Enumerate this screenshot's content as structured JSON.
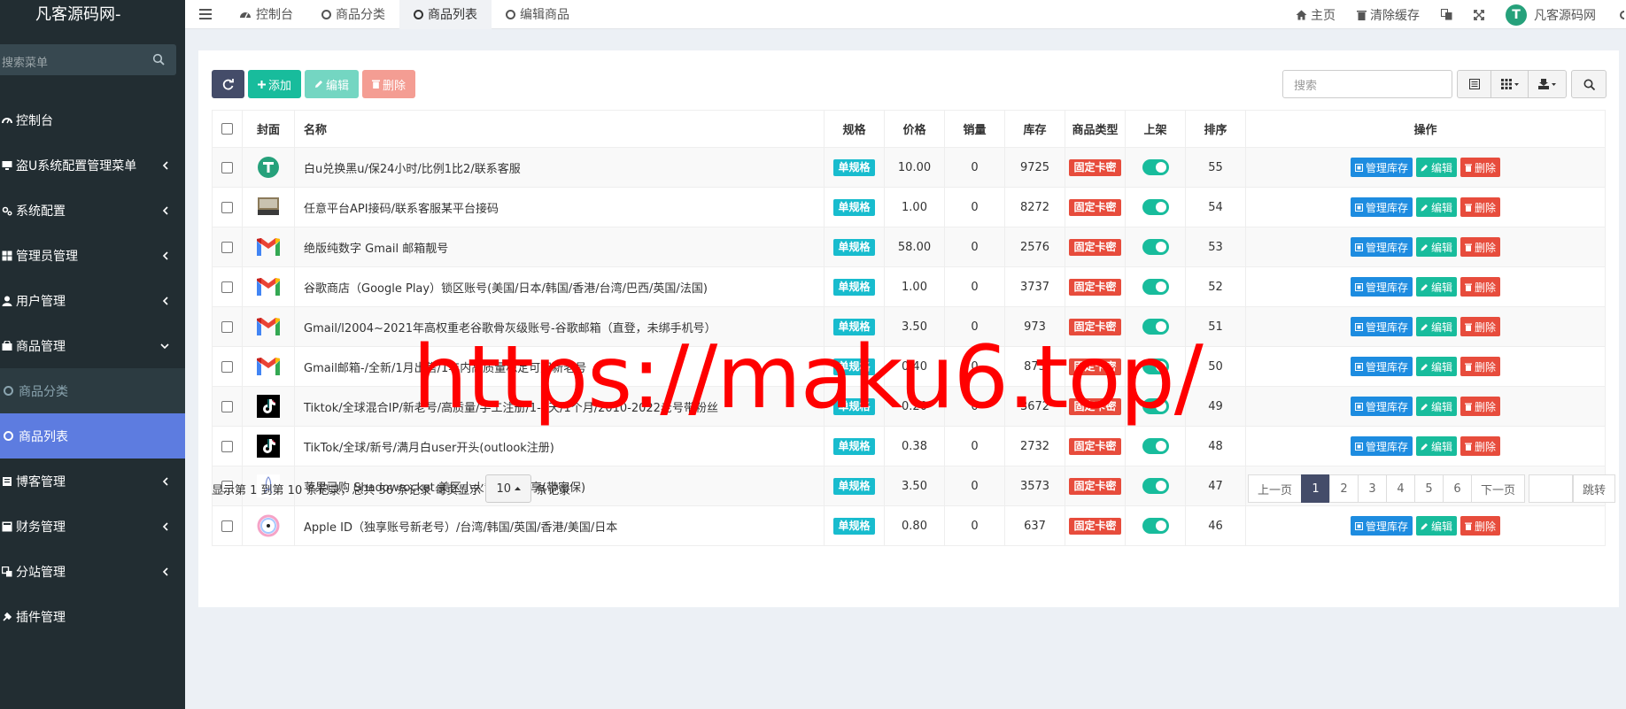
{
  "sidebar": {
    "brand": "凡客源码网-",
    "search_placeholder": "搜索菜单",
    "items": [
      {
        "label": "控制台",
        "icon": "dashboard-icon"
      },
      {
        "label": "盗U系统配置管理菜单",
        "icon": "desktop-icon"
      },
      {
        "label": "系统配置",
        "icon": "cogs-icon"
      },
      {
        "label": "管理员管理",
        "icon": "admin-icon"
      },
      {
        "label": "用户管理",
        "icon": "user-icon"
      },
      {
        "label": "商品管理",
        "icon": "shopping-bag-icon"
      },
      {
        "label": "博客管理",
        "icon": "book-icon"
      },
      {
        "label": "财务管理",
        "icon": "finance-icon"
      },
      {
        "label": "分站管理",
        "icon": "sitemap-icon"
      },
      {
        "label": "插件管理",
        "icon": "plugin-icon"
      }
    ],
    "sub_items": [
      {
        "label": "商品分类"
      },
      {
        "label": "商品列表"
      }
    ]
  },
  "topbar": {
    "tabs": [
      {
        "label": "控制台",
        "icon": "dashboard-icon"
      },
      {
        "label": "商品分类",
        "icon": "circle-icon"
      },
      {
        "label": "商品列表",
        "icon": "circle-icon"
      },
      {
        "label": "编辑商品",
        "icon": "circle-icon"
      }
    ],
    "home_label": "主页",
    "clear_cache_label": "清除缓存",
    "site_name": "凡客源码网"
  },
  "toolbar": {
    "add_label": "添加",
    "edit_label": "编辑",
    "delete_label": "删除",
    "search_placeholder": "搜索"
  },
  "table": {
    "columns": [
      "封面",
      "名称",
      "规格",
      "价格",
      "销量",
      "库存",
      "商品类型",
      "上架",
      "排序",
      "操作"
    ],
    "spec_label": "单规格",
    "type_label": "固定卡密",
    "op_stock_label": "管理库存",
    "op_edit_label": "编辑",
    "op_delete_label": "删除",
    "rows": [
      {
        "cover": "tether",
        "name": "白u兑换黑u/保24小时/比例1比2/联系客服",
        "price": "10.00",
        "sales": "0",
        "stock": "9725",
        "sort": "55"
      },
      {
        "cover": "laptop",
        "name": "任意平台API接码/联系客服某平台接码",
        "price": "1.00",
        "sales": "0",
        "stock": "8272",
        "sort": "54"
      },
      {
        "cover": "gmail",
        "name": "绝版纯数字 Gmail 邮箱靓号",
        "price": "58.00",
        "sales": "0",
        "stock": "2576",
        "sort": "53"
      },
      {
        "cover": "gmail",
        "name": "谷歌商店（Google Play）锁区账号(美国/日本/韩国/香港/台湾/巴西/英国/法国)",
        "price": "1.00",
        "sales": "0",
        "stock": "3737",
        "sort": "52"
      },
      {
        "cover": "gmail",
        "name": "Gmail/l2004~2021年高权重老谷歌骨灰级账号-谷歌邮箱（直登，未绑手机号）",
        "price": "3.50",
        "sales": "0",
        "stock": "973",
        "sort": "51"
      },
      {
        "cover": "gmail",
        "name": "Gmail邮箱-/全新/1月出售/1年内高质量稳定可用新老号",
        "price": "0.40",
        "sales": "0",
        "stock": "873",
        "sort": "50"
      },
      {
        "cover": "tiktok",
        "name": "Tiktok/全球混合IP/新老号/高质量/手工注册/1-7天/1个月/2010-2022老号带粉丝",
        "price": "0.20",
        "sales": "0",
        "stock": "3672",
        "sort": "49"
      },
      {
        "cover": "tiktok",
        "name": "TikTok/全球/新号/满月白user开头(outlook注册)",
        "price": "0.38",
        "sales": "0",
        "stock": "2732",
        "sort": "48"
      },
      {
        "cover": "rocket",
        "name": "苹果已购 Shadowrocket 美区小火箭账号独享(带密保)",
        "price": "3.50",
        "sales": "0",
        "stock": "3573",
        "sort": "47"
      },
      {
        "cover": "appleid",
        "name": "Apple ID（独享账号新老号）/台湾/韩国/英国/香港/美国/日本",
        "price": "0.80",
        "sales": "0",
        "stock": "637",
        "sort": "46"
      }
    ]
  },
  "footer": {
    "summary": "显示第 1 到第 10 条记录，总共 56 条记录 每页显示",
    "page_size": "10",
    "records_suffix": "条记录",
    "prev_label": "上一页",
    "next_label": "下一页",
    "pages": [
      "1",
      "2",
      "3",
      "4",
      "5",
      "6"
    ],
    "current_page": "1",
    "jump_label": "跳转"
  },
  "watermark": "https://maku6.top/",
  "colors": {
    "sidebar_bg": "#222d32",
    "active_menu": "#5d7ce0",
    "primary_dark": "#444c69",
    "success": "#18bc9c",
    "danger": "#e74c3c",
    "info": "#18bcce",
    "blue": "#1d8ce0"
  }
}
